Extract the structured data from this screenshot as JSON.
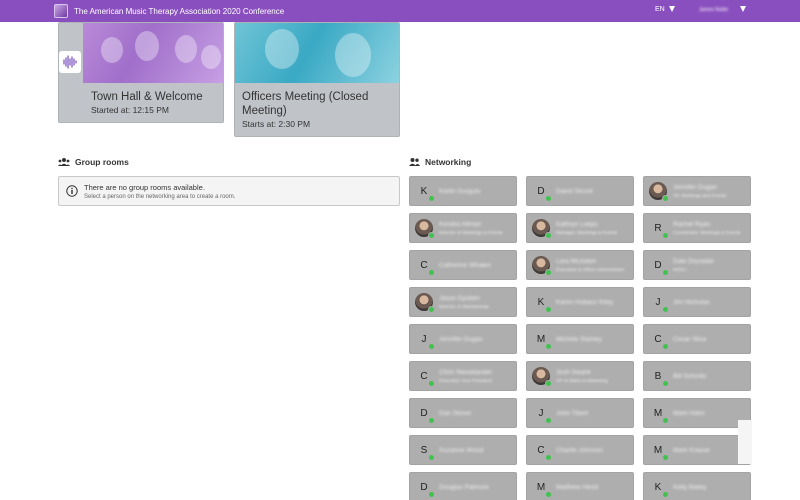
{
  "header": {
    "title": "The American Music Therapy Association 2020 Conference",
    "language": "EN",
    "user_name": "James Noble"
  },
  "sessions": [
    {
      "title": "Town Hall & Welcome",
      "time": "Started at: 12:15 PM"
    },
    {
      "title": "Officers Meeting (Closed Meeting)",
      "time": "Starts at: 2:30 PM"
    }
  ],
  "group_rooms": {
    "heading": "Group rooms",
    "empty_title": "There are no group rooms available.",
    "empty_subtitle": "Select a person on the networking area to create a room."
  },
  "networking": {
    "heading": "Networking",
    "people": [
      {
        "initial": "K",
        "name": "Karlin Gurgulo",
        "role": "",
        "photo": false
      },
      {
        "initial": "D",
        "name": "David Struck",
        "role": "",
        "photo": false
      },
      {
        "initial": "",
        "name": "Jennifer Dugan",
        "role": "VP, Meetings and Events",
        "photo": true
      },
      {
        "initial": "",
        "name": "Kendra Allman",
        "role": "Director of Meetings & Events",
        "photo": true
      },
      {
        "initial": "",
        "name": "Kathryn Leeps",
        "role": "Manager, Meetings & Events",
        "photo": true
      },
      {
        "initial": "R",
        "name": "Rachel Ryan",
        "role": "Coordinator, Meetings & Events",
        "photo": false
      },
      {
        "initial": "C",
        "name": "Catherine Whalen",
        "role": "",
        "photo": false
      },
      {
        "initial": "",
        "name": "Lara McAdam",
        "role": "Executive & Office Administrator",
        "photo": true
      },
      {
        "initial": "D",
        "name": "Dale Drysdale",
        "role": "NSGA",
        "photo": false
      },
      {
        "initial": "",
        "name": "Jason Epstein",
        "role": "Director of Membership",
        "photo": true
      },
      {
        "initial": "K",
        "name": "Karen Hubacz Kiley",
        "role": "",
        "photo": false
      },
      {
        "initial": "J",
        "name": "Jim Nicholas",
        "role": "",
        "photo": false
      },
      {
        "initial": "J",
        "name": "Jennifer Dugas",
        "role": "",
        "photo": false
      },
      {
        "initial": "M",
        "name": "Michele Stanley",
        "role": "",
        "photo": false
      },
      {
        "initial": "C",
        "name": "Cesar Silva",
        "role": "",
        "photo": false
      },
      {
        "initial": "C",
        "name": "Chris Nieuwlander",
        "role": "Executive Vice President",
        "photo": false
      },
      {
        "initial": "",
        "name": "Josh Swank",
        "role": "VP of Sales & Marketing",
        "photo": true
      },
      {
        "initial": "B",
        "name": "Bill Schmitz",
        "role": "",
        "photo": false
      },
      {
        "initial": "D",
        "name": "Dan Stover",
        "role": "",
        "photo": false
      },
      {
        "initial": "J",
        "name": "John Tibert",
        "role": "",
        "photo": false
      },
      {
        "initial": "M",
        "name": "Mark Hahn",
        "role": "",
        "photo": false
      },
      {
        "initial": "S",
        "name": "Suzanne Wood",
        "role": "",
        "photo": false
      },
      {
        "initial": "C",
        "name": "Charlie Johnson",
        "role": "",
        "photo": false
      },
      {
        "initial": "M",
        "name": "Mark Krause",
        "role": "",
        "photo": false
      },
      {
        "initial": "D",
        "name": "Douglas Palmore",
        "role": "",
        "photo": false
      },
      {
        "initial": "M",
        "name": "Matthew Hinck",
        "role": "",
        "photo": false
      },
      {
        "initial": "K",
        "name": "Kelly Bailey",
        "role": "",
        "photo": false
      }
    ]
  },
  "colors": {
    "header": "#8a4fbf",
    "card": "#c0c4c8",
    "person_card": "#aeaeae",
    "online": "#41c24f"
  }
}
